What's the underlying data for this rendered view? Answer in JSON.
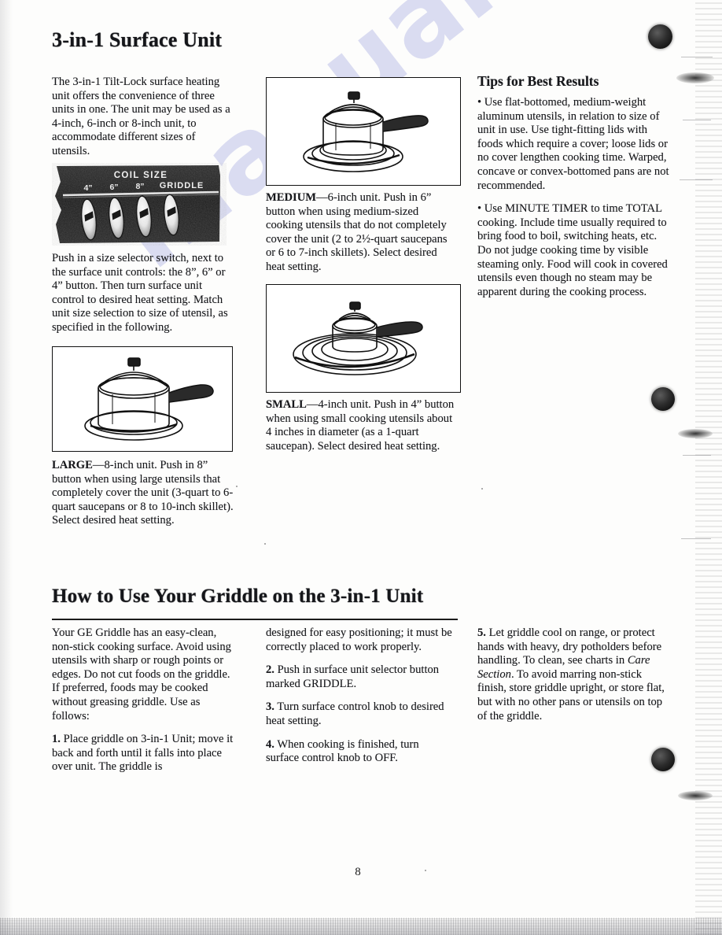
{
  "page": {
    "number": "8",
    "watermark": "manualslib.com"
  },
  "section1": {
    "title": "3-in-1 Surface Unit",
    "col1": {
      "intro": "The 3-in-1 Tilt-Lock surface heating unit offers the convenience of three units in one. The unit may be used as a 4-inch, 6-inch or 8-inch unit, to accommodate different sizes of utensils.",
      "after_photo": "Push in a size selector switch, next to the surface unit controls: the 8”, 6” or 4” button. Then turn surface unit control to desired heat setting. Match unit size selection to size of utensil, as specified in the following.",
      "panel_photo": {
        "caption": "COIL SIZE",
        "buttons": [
          "4”",
          "6”",
          "8”",
          "GRIDDLE"
        ]
      },
      "large_label": "LARGE",
      "large_text": "—8-inch unit. Push in 8” button when using large utensils that completely cover the unit (3-quart to 6-quart saucepans or 8 to 10-inch skillet). Select desired heat setting."
    },
    "col2": {
      "medium_label": "MEDIUM",
      "medium_text": "—6-inch unit. Push in 6” button when using medium-sized cooking utensils that do not completely cover the unit (2 to 2½-quart saucepans or 6 to 7-inch skillets). Select desired heat setting.",
      "small_label": "SMALL",
      "small_text": "—4-inch unit. Push in 4” button when using small cooking utensils about 4 inches in diameter (as a 1-quart saucepan). Select desired heat setting."
    },
    "col3": {
      "title": "Tips for Best Results",
      "bullet1": "• Use flat-bottomed, medium-weight aluminum utensils, in relation to size of unit in use. Use tight-fitting lids with foods which require a cover; loose lids or no cover lengthen cooking time. Warped, concave or convex-bottomed pans are not recommended.",
      "bullet2": "• Use MINUTE TIMER to time TOTAL cooking. Include time usually required to bring food to boil, switching heats, etc. Do not judge cooking time by visible steaming only. Food will cook in covered utensils even though no steam may be apparent during the cooking process."
    }
  },
  "section2": {
    "title": "How to Use Your Griddle on the 3-in-1 Unit",
    "col1": {
      "intro": "Your GE Griddle has an easy-clean, non-stick cooking surface. Avoid using utensils with sharp or rough points or edges. Do not cut foods on the griddle. If preferred, foods may be cooked without greasing griddle. Use as follows:",
      "step1_num": "1.",
      "step1_text": " Place griddle on 3-in-1 Unit; move it back and forth until it falls into place over unit. The griddle is"
    },
    "col2": {
      "step1_cont": "designed for easy positioning; it must be correctly placed to work properly.",
      "step2_num": "2.",
      "step2_text": " Push in surface unit selector button marked GRIDDLE.",
      "step3_num": "3.",
      "step3_text": " Turn surface control knob to desired heat setting.",
      "step4_num": "4.",
      "step4_text": " When cooking is finished, turn surface control knob to OFF."
    },
    "col3": {
      "step5_num": "5.",
      "step5_text_a": " Let griddle cool on range, or protect hands with heavy, dry potholders before handling. To clean, see charts in ",
      "step5_italic": "Care Section",
      "step5_text_b": ". To avoid marring non-stick finish, store griddle upright, or store flat, but with no other pans or utensils on top of the griddle."
    }
  },
  "figures": {
    "large": "saucepan-on-8-inch-coil-illustration",
    "medium": "saucepan-on-6-inch-coil-illustration",
    "small": "saucepan-on-4-inch-coil-illustration"
  }
}
